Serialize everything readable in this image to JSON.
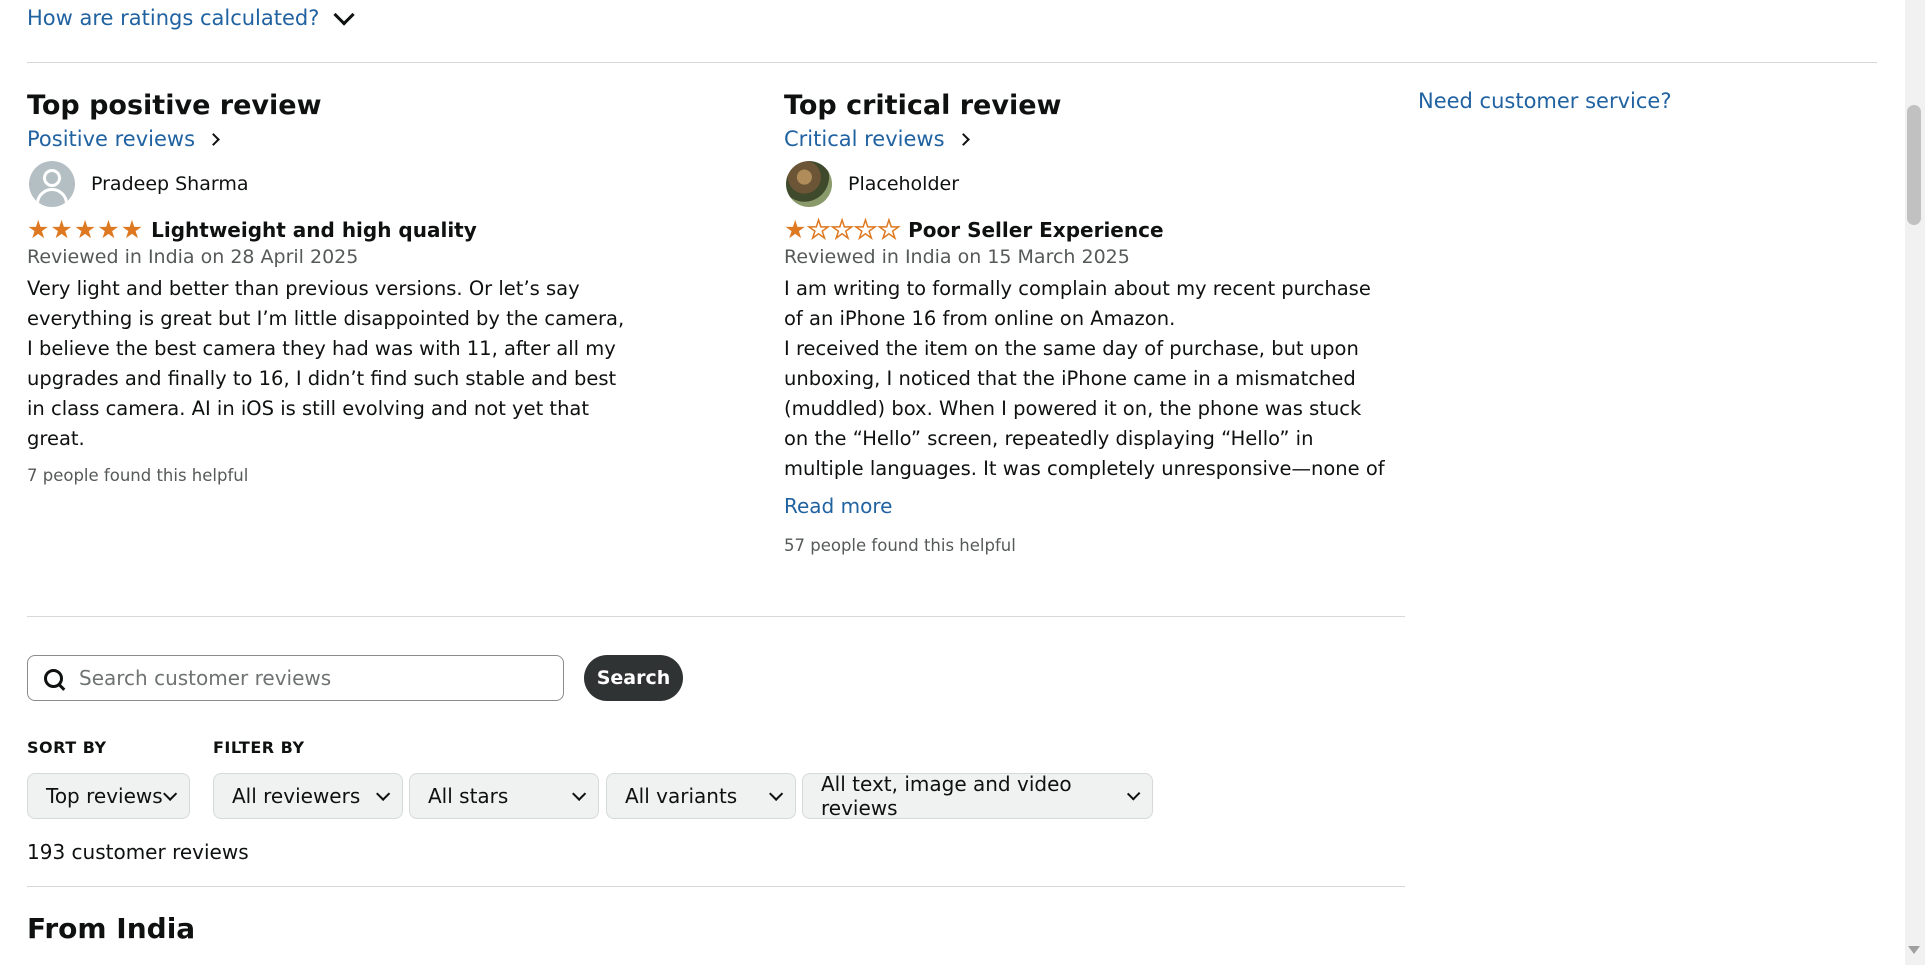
{
  "ratings_toggle": {
    "label": "How are ratings calculated?",
    "icon": "chevron-down-icon"
  },
  "positive": {
    "heading": "Top positive review",
    "link": "Positive reviews",
    "reviewer": "Pradeep Sharma",
    "rating": 5,
    "title": "Lightweight and high quality",
    "reviewed": "Reviewed in India on 28 April 2025",
    "body": "Very light and better than previous versions. Or let’s say everything is great but I’m little disappointed by the camera, I believe the best camera they had was with 11, after all my upgrades and finally to 16, I didn’t find such stable and best in class camera. AI in iOS is still evolving and not yet that great.",
    "helpful": "7 people found this helpful"
  },
  "critical": {
    "heading": "Top critical review",
    "link": "Critical reviews",
    "reviewer": "Placeholder",
    "rating": 1,
    "title": "Poor Seller Experience",
    "reviewed": "Reviewed in India on 15 March 2025",
    "body_line1": "I am writing to formally complain about my recent purchase of an iPhone 16 from online on Amazon.",
    "body_line2": "I received the item on the same day of purchase, but upon unboxing, I noticed that the iPhone came in a mismatched (muddled) box. When I powered it on, the phone was stuck on the “Hello” screen, repeatedly displaying “Hello” in multiple languages. It was completely unresponsive—none of the",
    "read_more": "Read more",
    "helpful": "57 people found this helpful"
  },
  "need_service": "Need customer service?",
  "search": {
    "placeholder": "Search customer reviews",
    "button": "Search"
  },
  "sort": {
    "label": "SORT BY",
    "selected": "Top reviews"
  },
  "filter": {
    "label": "FILTER BY",
    "options": [
      "All reviewers",
      "All stars",
      "All variants",
      "All text, image and video reviews"
    ]
  },
  "review_count": "193 customer reviews",
  "section_heading": "From India",
  "colors": {
    "link": "#2162a1",
    "star": "#de7921",
    "button_dark": "#303333"
  }
}
